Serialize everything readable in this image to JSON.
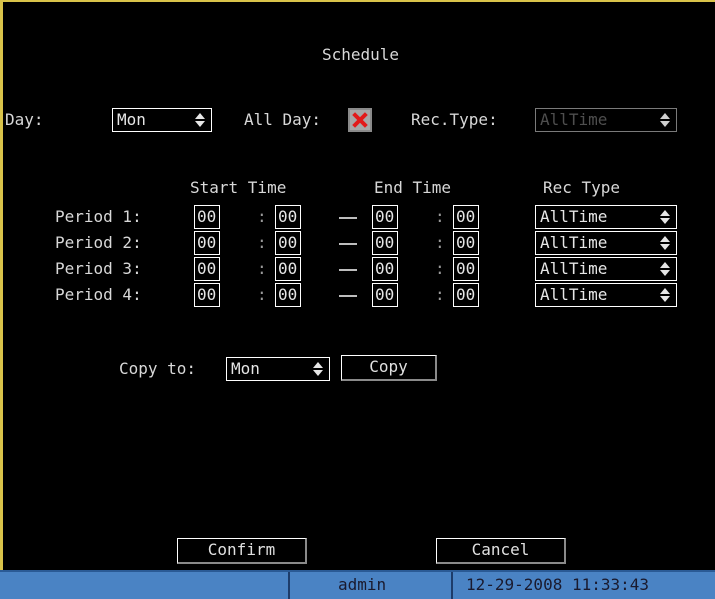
{
  "dialog": {
    "title": "Schedule"
  },
  "day_row": {
    "day_label": "Day:",
    "day_value": "Mon",
    "all_day_label": "All Day:",
    "all_day_checked": true,
    "rec_type_label": "Rec.Type:",
    "rec_type_value": "AllTime",
    "rec_type_enabled": false
  },
  "table": {
    "headers": {
      "start": "Start Time",
      "end": "End Time",
      "rec": "Rec Type"
    },
    "separator": ":",
    "periods": [
      {
        "label": "Period 1:",
        "start_h": "00",
        "start_m": "00",
        "end_h": "00",
        "end_m": "00",
        "rec_type": "AllTime"
      },
      {
        "label": "Period 2:",
        "start_h": "00",
        "start_m": "00",
        "end_h": "00",
        "end_m": "00",
        "rec_type": "AllTime"
      },
      {
        "label": "Period 3:",
        "start_h": "00",
        "start_m": "00",
        "end_h": "00",
        "end_m": "00",
        "rec_type": "AllTime"
      },
      {
        "label": "Period 4:",
        "start_h": "00",
        "start_m": "00",
        "end_h": "00",
        "end_m": "00",
        "rec_type": "AllTime"
      }
    ]
  },
  "copy": {
    "label": "Copy to:",
    "target": "Mon",
    "button": "Copy"
  },
  "buttons": {
    "confirm": "Confirm",
    "cancel": "Cancel"
  },
  "statusbar": {
    "user": "admin",
    "datetime": "12-29-2008 11:33:43"
  },
  "colors": {
    "frame": "#d9c34a",
    "statusbar": "#4a83c4",
    "checkbox_mark": "#e21b1b"
  },
  "icons": {
    "select_arrow": "up-down-arrows-icon",
    "checkbox_mark": "x-mark-icon"
  }
}
